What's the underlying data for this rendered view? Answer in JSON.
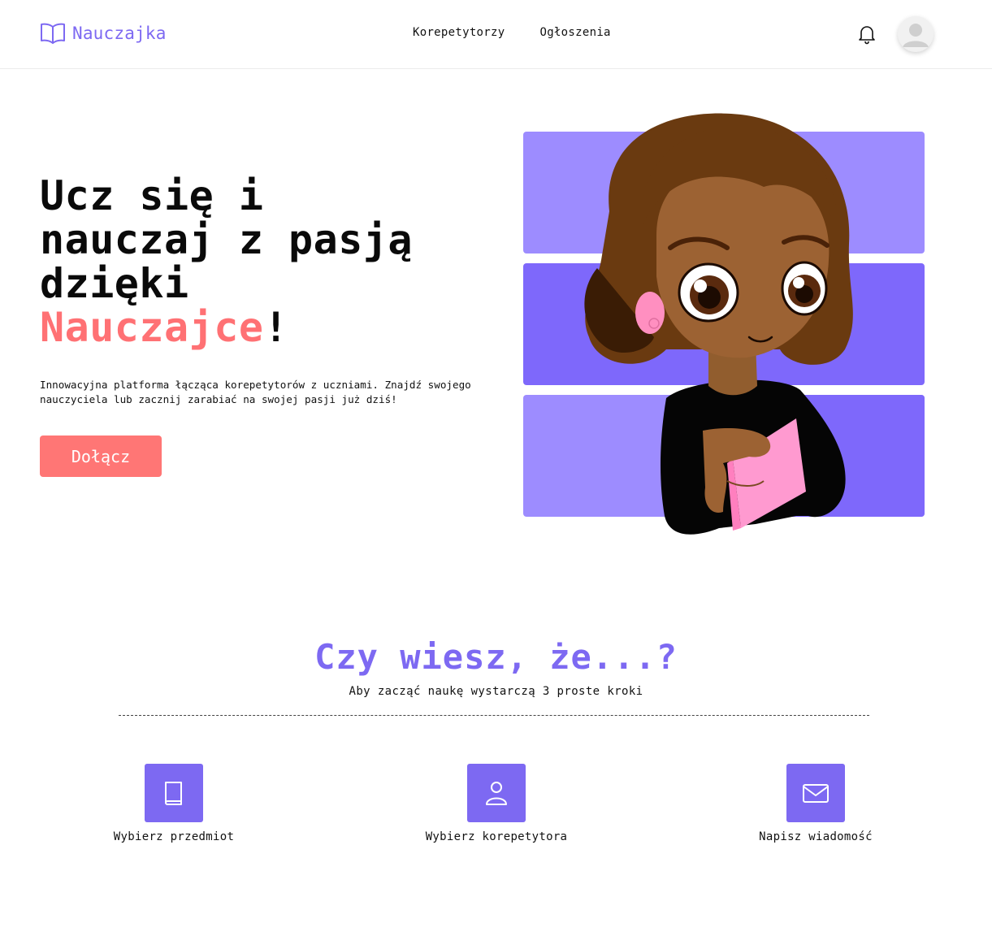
{
  "header": {
    "brand": "Nauczajka",
    "nav": [
      {
        "label": "Korepetytorzy"
      },
      {
        "label": "Ogłoszenia"
      }
    ],
    "icons": [
      "book-open-icon",
      "bell-icon",
      "user-avatar-icon"
    ]
  },
  "hero": {
    "title_line1": "Ucz się i",
    "title_line2": "nauczaj z pasją",
    "title_line3": "dzięki",
    "title_accent": "Nauczajce",
    "title_end": "!",
    "description": "Innowacyjna platforma łącząca korepetytorów z uczniami. Znajdź swojego nauczyciela lub zacznij zarabiać na swojej pasji już dziś!",
    "cta": "Dołącz"
  },
  "steps_section": {
    "title": "Czy wiesz, że...?",
    "subtitle": "Aby zacząć naukę wystarczą 3 proste kroki",
    "steps": [
      {
        "label": "Wybierz przedmiot",
        "icon": "book-icon"
      },
      {
        "label": "Wybierz korepetytora",
        "icon": "user-icon"
      },
      {
        "label": "Napisz wiadomość",
        "icon": "envelope-icon"
      }
    ]
  },
  "colors": {
    "brand": "#7d69f2",
    "accent": "#ff7174",
    "button": "#ff7675",
    "rect_light": "#9d8cff",
    "rect_dark": "#7e68fb"
  }
}
